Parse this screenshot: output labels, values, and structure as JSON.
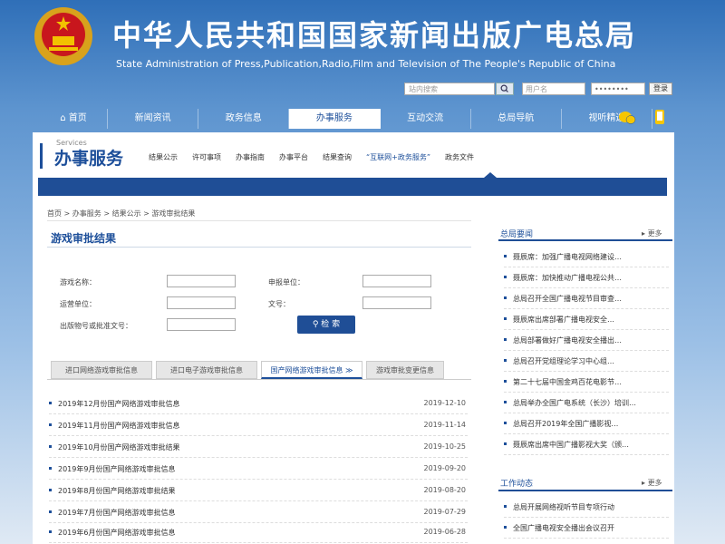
{
  "header": {
    "title_cn": "中华人民共和国国家新闻出版广电总局",
    "title_en": "State Administration of Press,Publication,Radio,Film and Television of The People's Republic of China",
    "search_placeholder": "站内搜索",
    "user_placeholder": "用户名",
    "password_mask": "••••••••",
    "login_label": "登录"
  },
  "nav": {
    "home": "首页",
    "items": [
      "新闻资讯",
      "政务信息",
      "办事服务",
      "互动交流",
      "总局导航",
      "视听精选"
    ],
    "active_index": 2
  },
  "services": {
    "small_label": "Services",
    "title": "办事服务",
    "links": [
      "结果公示",
      "许可事项",
      "办事指南",
      "办事平台",
      "结果查询",
      "“互联网+政务服务”",
      "政务文件"
    ]
  },
  "breadcrumb": [
    "首页",
    "办事服务",
    "结果公示",
    "游戏审批结果"
  ],
  "page_title": "游戏审批结果",
  "form": {
    "fields": [
      "游戏名称：",
      "申报单位：",
      "运营单位：",
      "文号：",
      "出版物号或批准文号："
    ],
    "search_label": "检 索"
  },
  "tabs": [
    "进口网络游戏审批信息",
    "进口电子游戏审批信息",
    "国产网络游戏审批信息 ≫",
    "游戏审批变更信息"
  ],
  "tabs_active": 2,
  "list": [
    {
      "title": "2019年12月份国产网络游戏审批信息",
      "date": "2019-12-10"
    },
    {
      "title": "2019年11月份国产网络游戏审批信息",
      "date": "2019-11-14"
    },
    {
      "title": "2019年10月份国产网络游戏审批结果",
      "date": "2019-10-25"
    },
    {
      "title": "2019年9月份国产网络游戏审批信息",
      "date": "2019-09-20"
    },
    {
      "title": "2019年8月份国产网络游戏审批结果",
      "date": "2019-08-20"
    },
    {
      "title": "2019年7月份国产网络游戏审批信息",
      "date": "2019-07-29"
    },
    {
      "title": "2019年6月份国产网络游戏审批信息",
      "date": "2019-06-28"
    }
  ],
  "sidebar": {
    "news_title": "总局要闻",
    "more": "更多",
    "news_items": [
      "聂辰席：加强广播电视网络建设…",
      "聂辰席：加快推动广播电视公共…",
      "总局召开全国广播电视节目审查…",
      "聂辰席出席部署广播电视安全…",
      "总局部署做好广播电视安全播出…",
      "总局召开党组理论学习中心组…",
      "第二十七届中国金鸡百花电影节…",
      "总局举办全国广电系统（长沙）培训…",
      "总局召开2019年全国广播影视…",
      "聂辰席出席中国广播影视大奖（颁…"
    ],
    "work_title": "工作动态",
    "work_items": [
      "总局开展网络视听节目专项行动",
      "全国广播电视安全播出会议召开"
    ]
  }
}
